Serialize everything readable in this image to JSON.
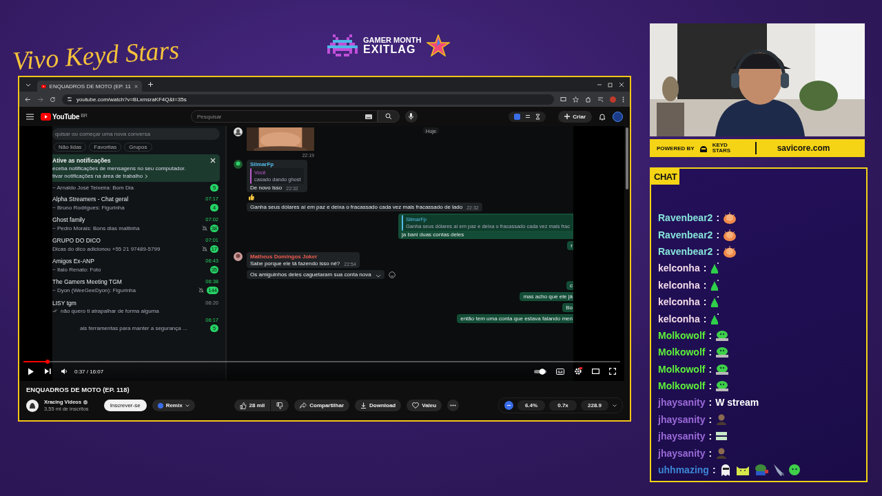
{
  "overlay": {
    "script_logo": "Vivo Keyd Stars",
    "event_title": "GAMER MONTH",
    "event_brand": "EXITLAG",
    "powered_by": "POWERED BY",
    "sponsor": "KEYD STARS",
    "site": "savicore.com"
  },
  "browser": {
    "tab_title": "ENQUADROS DE MOTO (EP. 11",
    "url": "youtube.com/watch?v=BLxmsraKF4Q&t=35s"
  },
  "youtube": {
    "logo": "YouTube",
    "region": "BR",
    "search_placeholder": "Pesquisar",
    "create": "Criar"
  },
  "whatsapp": {
    "search_placeholder": "quisar ou começar uma nova conversa",
    "filters": [
      {
        "label": "Não lidas",
        "selected": false
      },
      {
        "label": "Favoritas",
        "selected": false
      },
      {
        "label": "Grupos",
        "selected": false
      }
    ],
    "notice": {
      "title": "Ative as notificações",
      "text": "eceba notificações de mensagens no seu computador.",
      "link": "tivar notificações na área de trabalho"
    },
    "chats": [
      {
        "preview": "~ Arnaldo José Teixeira: Bom Dia",
        "unread": "5",
        "muted": false,
        "read_ticks": false
      },
      {
        "name": "Alpha Streamers - Chat geral",
        "preview": "~ Bruno Rodrigues: Figurinha",
        "time": "07:17",
        "unread": "4",
        "muted": false,
        "read_ticks": false
      },
      {
        "name": "Ghost family",
        "preview": "~ Pedro Morais: Bons dias maltinha",
        "time": "07:02",
        "unread": "38",
        "muted": true,
        "read_ticks": false
      },
      {
        "name": "GRUPO DO DICO",
        "preview": "Dicas do dico adicionou +55 21 97489-5799",
        "time": "07:01",
        "unread": "17",
        "muted": true,
        "read_ticks": false
      },
      {
        "name": "Amigos Ex-ANP",
        "preview": "~ Italo Renato: Foto",
        "time": "06:43",
        "unread": "35",
        "muted": false,
        "read_ticks": false
      },
      {
        "name": "The Gamers Meeting TGM",
        "preview": "~ Dyon (WeeGeeDyon): Figurinha",
        "time": "06:38",
        "unread": "144",
        "muted": true,
        "read_ticks": false
      },
      {
        "name": "LISY tgm",
        "preview": "não quero ti atrapalhar de forma alguma",
        "time": "06:20",
        "muted": false,
        "read_ticks": true
      },
      {
        "preview": "ais ferramentas para manter a segurança ...",
        "time": "06:17",
        "unread": "5",
        "muted": false,
        "read_ticks": false
      }
    ],
    "messages": [
      {
        "kind": "date",
        "text": "Hoje"
      },
      {
        "time": "22:19"
      },
      {
        "kind": "incoming",
        "sender": "SilmarFp",
        "color": "#53bdeb",
        "quote_author": "Você",
        "quote_text": "casado dando ghost",
        "text": "De novo isso",
        "time": "22:32",
        "reaction": true
      },
      {
        "kind": "incoming",
        "text": "Ganha seus dólares aí em paz e deixa o fracassado cada vez mais fracassado de lado",
        "time": "22:32",
        "reaction": false
      },
      {
        "kind": "outgoing",
        "quote_author": "SilmarFp",
        "quote_text": "Ganha seus dólares aí em paz e deixa o fracassado cada vez mais frac",
        "text": "ja bani duas contas deles"
      },
      {
        "kind": "outgoing",
        "text": "r"
      },
      {
        "kind": "incoming",
        "sender": "Matheus Domingos Joker",
        "color": "#f15c4f",
        "text": "Sabe porque ele tá fazendo isso né?",
        "time": "22:54",
        "reaction": false
      },
      {
        "kind": "incoming",
        "text": "Os amiguinhos deles caguetaram sua conta nova",
        "hover": true,
        "reaction": false
      },
      {
        "kind": "outgoing",
        "text": "c"
      },
      {
        "kind": "outgoing",
        "text": "mas acho que ele já"
      },
      {
        "kind": "outgoing",
        "text": "Bo"
      },
      {
        "kind": "outgoing",
        "text": "então tem uma conta que estava falando men"
      }
    ]
  },
  "player": {
    "time": "0:37 / 16:07",
    "level": 0.04
  },
  "video": {
    "title": "ENQUADROS DE MOTO (EP. 118)",
    "channel": "Xracing Videos",
    "subscribers": "3,55 mi de inscritos",
    "subscribe": "Inscrever-se",
    "remix": "Remix",
    "likes": "28 mil",
    "share": "Compartilhar",
    "download": "Download",
    "thanks": "Valeu"
  },
  "extension": {
    "values": [
      "6.4%",
      "0.7x",
      "228.9"
    ]
  },
  "chat": {
    "title": "CHAT",
    "messages": [
      {
        "user": "Ravenbear2",
        "color": "#86e3d9",
        "separator": ":",
        "emotes": [
          {
            "kind": "cheer"
          }
        ]
      },
      {
        "user": "Ravenbear2",
        "color": "#86e3d9",
        "separator": ":",
        "emotes": [
          {
            "kind": "cheer"
          }
        ]
      },
      {
        "user": "Ravenbear2",
        "color": "#86e3d9",
        "separator": ":",
        "emotes": [
          {
            "kind": "cheer"
          }
        ]
      },
      {
        "user": "kelconha",
        "color": "#f3dbe9",
        "separator": ":",
        "emotes": [
          {
            "kind": "slime"
          }
        ]
      },
      {
        "user": "kelconha",
        "color": "#f3dbe9",
        "separator": ":",
        "emotes": [
          {
            "kind": "slime"
          }
        ]
      },
      {
        "user": "kelconha",
        "color": "#f3dbe9",
        "separator": ":",
        "emotes": [
          {
            "kind": "slime"
          }
        ]
      },
      {
        "user": "kelconha",
        "color": "#f3dbe9",
        "separator": ":",
        "emotes": [
          {
            "kind": "slime"
          }
        ]
      },
      {
        "user": "Molkowolf",
        "color": "#5df03a",
        "separator": ":",
        "emotes": [
          {
            "kind": "blob"
          }
        ]
      },
      {
        "user": "Molkowolf",
        "color": "#5df03a",
        "separator": ":",
        "emotes": [
          {
            "kind": "blob"
          }
        ]
      },
      {
        "user": "Molkowolf",
        "color": "#5df03a",
        "separator": ":",
        "emotes": [
          {
            "kind": "blob"
          }
        ]
      },
      {
        "user": "Molkowolf",
        "color": "#5df03a",
        "separator": ":",
        "emotes": [
          {
            "kind": "blob"
          }
        ]
      },
      {
        "user": "jhaysanity",
        "color": "#9b6bd9",
        "separator": ":",
        "text": "W stream"
      },
      {
        "user": "jhaysanity",
        "color": "#9b6bd9",
        "separator": ":",
        "emotes": [
          {
            "kind": "portrait"
          }
        ]
      },
      {
        "user": "jhaysanity",
        "color": "#9b6bd9",
        "separator": ":",
        "emotes": [
          {
            "kind": "badge"
          }
        ]
      },
      {
        "user": "jhaysanity",
        "color": "#9b6bd9",
        "separator": ":",
        "emotes": [
          {
            "kind": "portrait"
          }
        ]
      },
      {
        "user": "uhhmazing",
        "color": "#3c86d6",
        "separator": ":",
        "emotes": [
          {
            "kind": "ghost"
          },
          {
            "kind": "cat"
          },
          {
            "kind": "frog"
          },
          {
            "kind": "shark"
          },
          {
            "kind": "green"
          }
        ]
      }
    ]
  }
}
